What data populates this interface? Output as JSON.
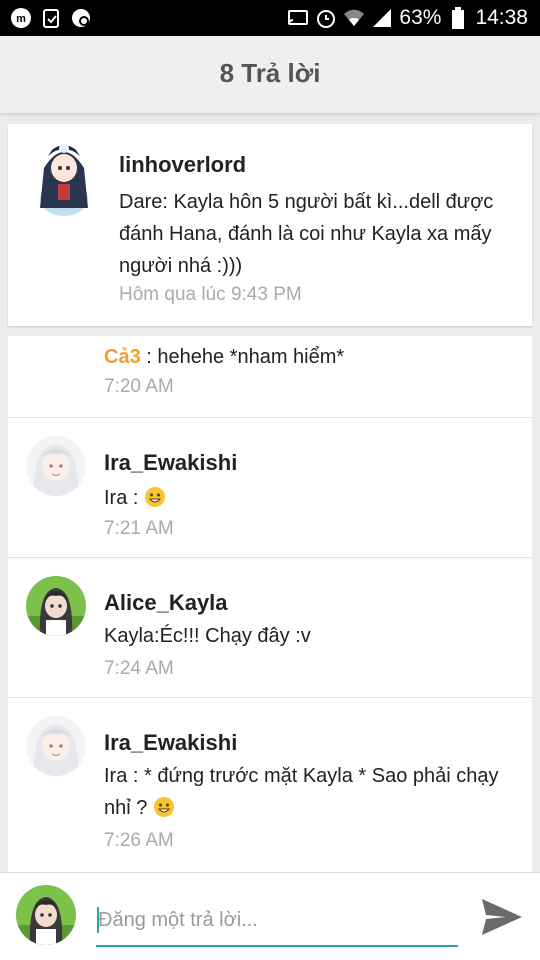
{
  "status_bar": {
    "battery_percent": "63%",
    "time": "14:38",
    "icons": [
      "messenger-icon",
      "clipboard-icon",
      "pin-icon",
      "cast-icon",
      "alarm-icon",
      "wifi-icon",
      "signal-icon",
      "battery-icon"
    ]
  },
  "header": {
    "title": "8 Trả lời"
  },
  "main_post": {
    "username": "linhoverlord",
    "text": "Dare: Kayla hôn 5 người bất kì...dell được đánh Hana, đánh là coi như Kayla xa mấy người nhá :)))",
    "time": "Hôm qua lúc 9:43 PM"
  },
  "replies": [
    {
      "name": "Cả3",
      "text": " : hehehe *nham hiểm*",
      "time": "7:20 AM",
      "partial": true
    },
    {
      "username": "Ira_Ewakishi",
      "text": "Ira : ",
      "emoji": "grin-emoji",
      "time": "7:21 AM"
    },
    {
      "username": "Alice_Kayla",
      "text": "Kayla:Éc!!! Chạy đây :v",
      "time": "7:24 AM"
    },
    {
      "username": "Ira_Ewakishi",
      "text": "Ira : * đứng trước mặt Kayla * Sao phải chạy nhỉ ? ",
      "emoji": "grin-emoji",
      "time": "7:26 AM"
    }
  ],
  "composer": {
    "placeholder": "Đăng một trả lời..."
  },
  "colors": {
    "accent": "#27a7a0",
    "name_orange": "#f0a030",
    "header_bg": "#efefef",
    "time_gray": "#aaaaaa"
  }
}
